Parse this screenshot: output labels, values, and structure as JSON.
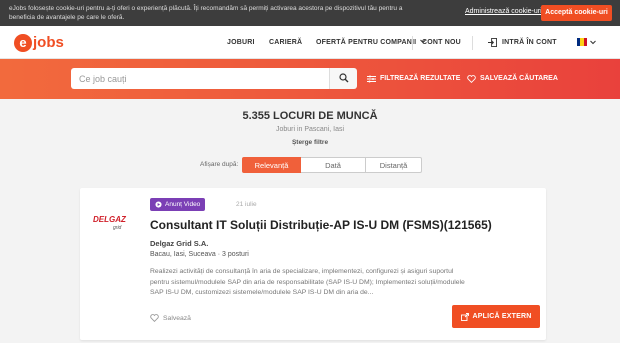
{
  "cookie": {
    "text": "eJobs folosește cookie-uri pentru a-ți oferi o experiență plăcută. Îți recomandăm să permiți activarea acestora pe dispozitivul tău pentru a beneficia de avantajele pe care le oferă.",
    "manage_label": "Administrează cookie-uri",
    "accept_label": "Acceptă cookie-uri"
  },
  "header": {
    "logo_mark": "e",
    "logo_word": "jobs",
    "nav": [
      "JOBURI",
      "CARIERĂ",
      "OFERTĂ PENTRU COMPANII",
      "CONT NOU",
      "INTRĂ ÎN CONT"
    ]
  },
  "search": {
    "placeholder": "Ce job cauți",
    "filter_label": "FILTREAZĂ REZULTATE",
    "save_label": "SALVEAZĂ CĂUTAREA"
  },
  "results": {
    "count": "5.355 LOCURI DE MUNCĂ",
    "subtitle": "Joburi in Pascani, Iasi",
    "clear_filters": "Șterge filtre",
    "sort_label": "Afișare după:",
    "sort_options": [
      "Relevanță",
      "Dată",
      "Distanță"
    ]
  },
  "job": {
    "badge": "Anunț Video",
    "date": "21 iulie",
    "company_logo": "DELGAZ",
    "company_logo_sub": "grid",
    "title": "Consultant IT Soluții Distribuție-AP IS-U DM (FSMS)(121565)",
    "company": "Delgaz Grid S.A.",
    "location": "Bacau, Iasi, Suceava · 3 posturi",
    "description": "Realizezi activități de consultanță în aria de specializare, implementezi, configurezi și asiguri suportul pentru sistemul/modulele SAP din aria de responsabilitate (SAP IS-U DM); Implementezi soluții/modulele SAP IS-U DM, customizezi sistemele/modulele SAP IS-U DM din aria de...",
    "save_label": "Salvează",
    "apply_label": "APLICĂ EXTERN"
  },
  "colors": {
    "accent": "#f04e23",
    "badge": "#7b3fb5"
  }
}
